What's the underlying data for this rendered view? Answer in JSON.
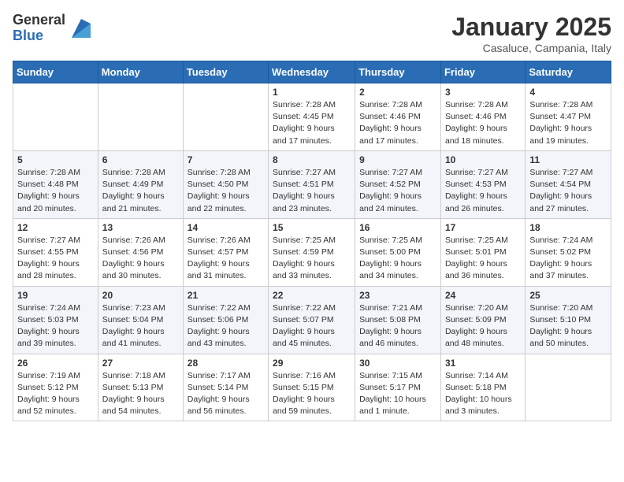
{
  "logo": {
    "general": "General",
    "blue": "Blue"
  },
  "title": "January 2025",
  "location": "Casaluce, Campania, Italy",
  "days_of_week": [
    "Sunday",
    "Monday",
    "Tuesday",
    "Wednesday",
    "Thursday",
    "Friday",
    "Saturday"
  ],
  "weeks": [
    [
      {
        "day": "",
        "info": ""
      },
      {
        "day": "",
        "info": ""
      },
      {
        "day": "",
        "info": ""
      },
      {
        "day": "1",
        "info": "Sunrise: 7:28 AM\nSunset: 4:45 PM\nDaylight: 9 hours\nand 17 minutes."
      },
      {
        "day": "2",
        "info": "Sunrise: 7:28 AM\nSunset: 4:46 PM\nDaylight: 9 hours\nand 17 minutes."
      },
      {
        "day": "3",
        "info": "Sunrise: 7:28 AM\nSunset: 4:46 PM\nDaylight: 9 hours\nand 18 minutes."
      },
      {
        "day": "4",
        "info": "Sunrise: 7:28 AM\nSunset: 4:47 PM\nDaylight: 9 hours\nand 19 minutes."
      }
    ],
    [
      {
        "day": "5",
        "info": "Sunrise: 7:28 AM\nSunset: 4:48 PM\nDaylight: 9 hours\nand 20 minutes."
      },
      {
        "day": "6",
        "info": "Sunrise: 7:28 AM\nSunset: 4:49 PM\nDaylight: 9 hours\nand 21 minutes."
      },
      {
        "day": "7",
        "info": "Sunrise: 7:28 AM\nSunset: 4:50 PM\nDaylight: 9 hours\nand 22 minutes."
      },
      {
        "day": "8",
        "info": "Sunrise: 7:27 AM\nSunset: 4:51 PM\nDaylight: 9 hours\nand 23 minutes."
      },
      {
        "day": "9",
        "info": "Sunrise: 7:27 AM\nSunset: 4:52 PM\nDaylight: 9 hours\nand 24 minutes."
      },
      {
        "day": "10",
        "info": "Sunrise: 7:27 AM\nSunset: 4:53 PM\nDaylight: 9 hours\nand 26 minutes."
      },
      {
        "day": "11",
        "info": "Sunrise: 7:27 AM\nSunset: 4:54 PM\nDaylight: 9 hours\nand 27 minutes."
      }
    ],
    [
      {
        "day": "12",
        "info": "Sunrise: 7:27 AM\nSunset: 4:55 PM\nDaylight: 9 hours\nand 28 minutes."
      },
      {
        "day": "13",
        "info": "Sunrise: 7:26 AM\nSunset: 4:56 PM\nDaylight: 9 hours\nand 30 minutes."
      },
      {
        "day": "14",
        "info": "Sunrise: 7:26 AM\nSunset: 4:57 PM\nDaylight: 9 hours\nand 31 minutes."
      },
      {
        "day": "15",
        "info": "Sunrise: 7:25 AM\nSunset: 4:59 PM\nDaylight: 9 hours\nand 33 minutes."
      },
      {
        "day": "16",
        "info": "Sunrise: 7:25 AM\nSunset: 5:00 PM\nDaylight: 9 hours\nand 34 minutes."
      },
      {
        "day": "17",
        "info": "Sunrise: 7:25 AM\nSunset: 5:01 PM\nDaylight: 9 hours\nand 36 minutes."
      },
      {
        "day": "18",
        "info": "Sunrise: 7:24 AM\nSunset: 5:02 PM\nDaylight: 9 hours\nand 37 minutes."
      }
    ],
    [
      {
        "day": "19",
        "info": "Sunrise: 7:24 AM\nSunset: 5:03 PM\nDaylight: 9 hours\nand 39 minutes."
      },
      {
        "day": "20",
        "info": "Sunrise: 7:23 AM\nSunset: 5:04 PM\nDaylight: 9 hours\nand 41 minutes."
      },
      {
        "day": "21",
        "info": "Sunrise: 7:22 AM\nSunset: 5:06 PM\nDaylight: 9 hours\nand 43 minutes."
      },
      {
        "day": "22",
        "info": "Sunrise: 7:22 AM\nSunset: 5:07 PM\nDaylight: 9 hours\nand 45 minutes."
      },
      {
        "day": "23",
        "info": "Sunrise: 7:21 AM\nSunset: 5:08 PM\nDaylight: 9 hours\nand 46 minutes."
      },
      {
        "day": "24",
        "info": "Sunrise: 7:20 AM\nSunset: 5:09 PM\nDaylight: 9 hours\nand 48 minutes."
      },
      {
        "day": "25",
        "info": "Sunrise: 7:20 AM\nSunset: 5:10 PM\nDaylight: 9 hours\nand 50 minutes."
      }
    ],
    [
      {
        "day": "26",
        "info": "Sunrise: 7:19 AM\nSunset: 5:12 PM\nDaylight: 9 hours\nand 52 minutes."
      },
      {
        "day": "27",
        "info": "Sunrise: 7:18 AM\nSunset: 5:13 PM\nDaylight: 9 hours\nand 54 minutes."
      },
      {
        "day": "28",
        "info": "Sunrise: 7:17 AM\nSunset: 5:14 PM\nDaylight: 9 hours\nand 56 minutes."
      },
      {
        "day": "29",
        "info": "Sunrise: 7:16 AM\nSunset: 5:15 PM\nDaylight: 9 hours\nand 59 minutes."
      },
      {
        "day": "30",
        "info": "Sunrise: 7:15 AM\nSunset: 5:17 PM\nDaylight: 10 hours\nand 1 minute."
      },
      {
        "day": "31",
        "info": "Sunrise: 7:14 AM\nSunset: 5:18 PM\nDaylight: 10 hours\nand 3 minutes."
      },
      {
        "day": "",
        "info": ""
      }
    ]
  ]
}
